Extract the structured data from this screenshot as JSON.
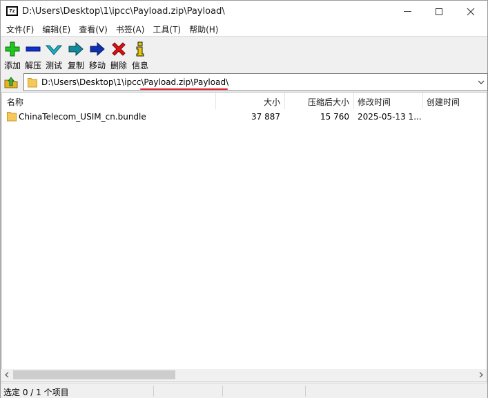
{
  "window": {
    "app_icon_text": "7z",
    "title": "D:\\Users\\Desktop\\1\\ipcc\\Payload.zip\\Payload\\"
  },
  "menu": {
    "items": [
      "文件(F)",
      "编辑(E)",
      "查看(V)",
      "书签(A)",
      "工具(T)",
      "帮助(H)"
    ]
  },
  "toolbar": {
    "buttons": [
      {
        "label": "添加",
        "icon": "add-plus-icon",
        "color": "#1ec81e"
      },
      {
        "label": "解压",
        "icon": "extract-minus-icon",
        "color": "#1030d0"
      },
      {
        "label": "测试",
        "icon": "test-check-icon",
        "color": "#18b4c8"
      },
      {
        "label": "复制",
        "icon": "copy-arrow-icon",
        "color": "#138a9c"
      },
      {
        "label": "移动",
        "icon": "move-arrow-icon",
        "color": "#1030b0"
      },
      {
        "label": "删除",
        "icon": "delete-x-icon",
        "color": "#e01010"
      },
      {
        "label": "信息",
        "icon": "info-icon",
        "color": "#e8c800"
      }
    ]
  },
  "address": {
    "path": "D:\\Users\\Desktop\\1\\ipcc\\Payload.zip\\Payload\\",
    "highlight_color": "#e0202a"
  },
  "columns": {
    "name": "名称",
    "size": "大小",
    "packed_size": "压缩后大小",
    "modified": "修改时间",
    "created": "创建时间"
  },
  "files": [
    {
      "name": "ChinaTelecom_USIM_cn.bundle",
      "size": "37 887",
      "packed_size": "15 760",
      "modified": "2025-05-13 1...",
      "created": ""
    }
  ],
  "status": {
    "selection": "选定 0 / 1 个项目"
  }
}
